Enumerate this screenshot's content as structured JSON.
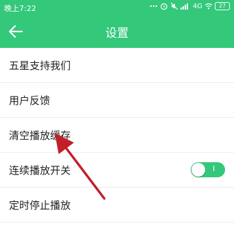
{
  "status_bar": {
    "time": "晚上7:22",
    "network": "4G",
    "battery": "27"
  },
  "header": {
    "back_icon": "arrow-left-icon",
    "title": "设置"
  },
  "settings": [
    {
      "label": "五星支持我们"
    },
    {
      "label": "用户反馈"
    },
    {
      "label": "清空播放缓存"
    },
    {
      "label": "连续播放开关",
      "toggle": {
        "on": true,
        "text": "I"
      }
    },
    {
      "label": "定时停止播放"
    }
  ],
  "colors": {
    "accent": "#33c87a",
    "annotation_arrow": "#c21f2b"
  },
  "annotation": {
    "type": "arrow",
    "target": "清空播放缓存"
  }
}
